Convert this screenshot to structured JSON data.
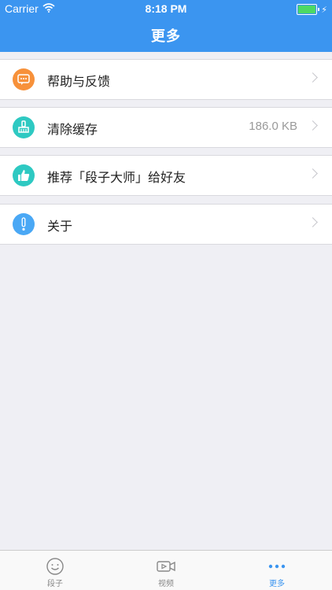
{
  "status_bar": {
    "carrier": "Carrier",
    "time": "8:18 PM"
  },
  "header": {
    "title": "更多"
  },
  "menu": {
    "help": {
      "label": "帮助与反馈",
      "icon": "chat-bubble-icon",
      "color": "#f7913a"
    },
    "cache": {
      "label": "清除缓存",
      "value": "186.0 KB",
      "icon": "brush-icon",
      "color": "#2ec9c2"
    },
    "recommend": {
      "label": "推荐「段子大师」给好友",
      "icon": "thumbs-up-icon",
      "color": "#2ec9c2"
    },
    "about": {
      "label": "关于",
      "icon": "exclamation-icon",
      "color": "#4aa8f5"
    }
  },
  "tabbar": {
    "jokes": {
      "label": "段子",
      "icon": "smiley-icon"
    },
    "video": {
      "label": "视频",
      "icon": "video-camera-icon"
    },
    "more": {
      "label": "更多",
      "icon": "more-dots-icon"
    }
  },
  "colors": {
    "accent": "#3b95f0",
    "background": "#efeff4"
  }
}
